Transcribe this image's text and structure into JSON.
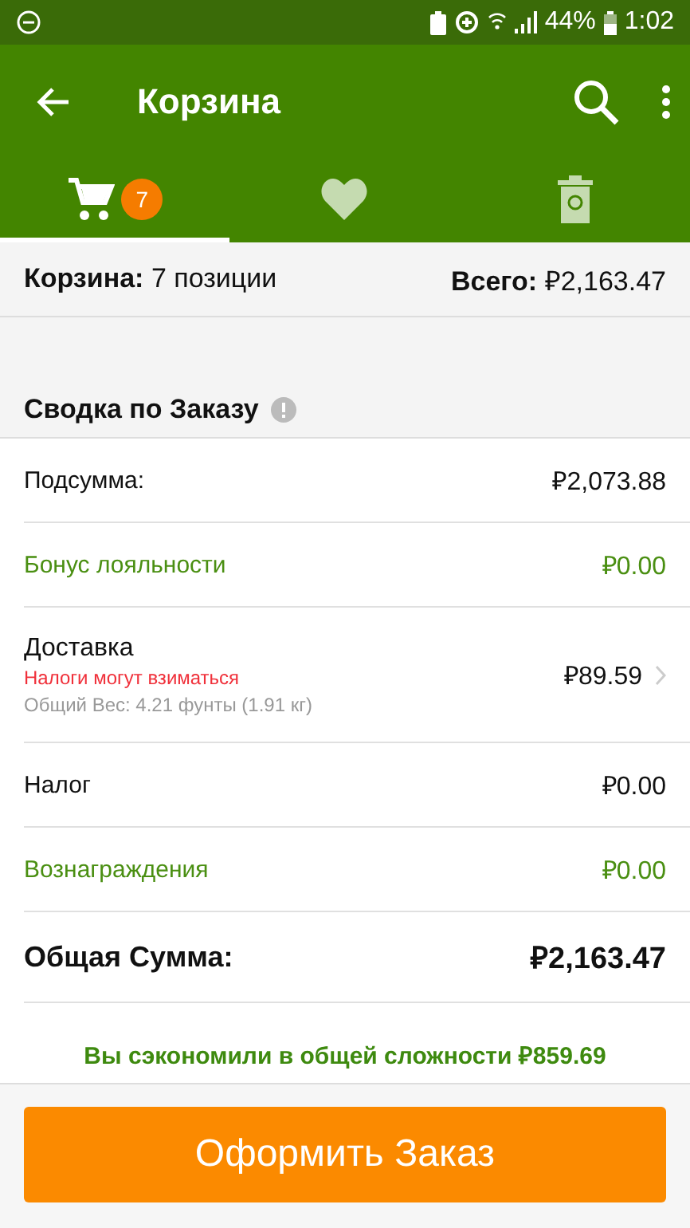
{
  "status_bar": {
    "battery": "44%",
    "time": "1:02"
  },
  "toolbar": {
    "title": "Корзина"
  },
  "tabs": [
    {
      "kind": "cart",
      "selected": true,
      "badge": "7"
    },
    {
      "kind": "favorites",
      "selected": false
    },
    {
      "kind": "trash",
      "selected": false
    }
  ],
  "cart_summary": {
    "items": "**Корзина:** 7 позиции",
    "total": "**Всего:** ₽2,163.47"
  },
  "order_summary": {
    "heading": "Сводка по Заказу",
    "rows": [
      {
        "kind": "plain",
        "label": "Подсумма:",
        "value": "₽2,073.88"
      },
      {
        "kind": "green",
        "label": "Бонус лояльности",
        "value": "₽0.00"
      },
      {
        "kind": "shipping",
        "label": "Доставка",
        "note": "Налоги могут взиматься",
        "detail": "Общий Вес: 4.21 фунты (1.91 кг)",
        "value": "₽89.59"
      },
      {
        "kind": "plain",
        "label": "Налог",
        "value": "₽0.00"
      },
      {
        "kind": "green",
        "label": "Вознаграждения",
        "value": "₽0.00"
      },
      {
        "kind": "total",
        "label": "Общая Сумма:",
        "value": "₽2,163.47"
      }
    ],
    "savings": "Вы сэкономили в общей сложности ₽859.69"
  },
  "checkout_button": "Оформить Заказ"
}
